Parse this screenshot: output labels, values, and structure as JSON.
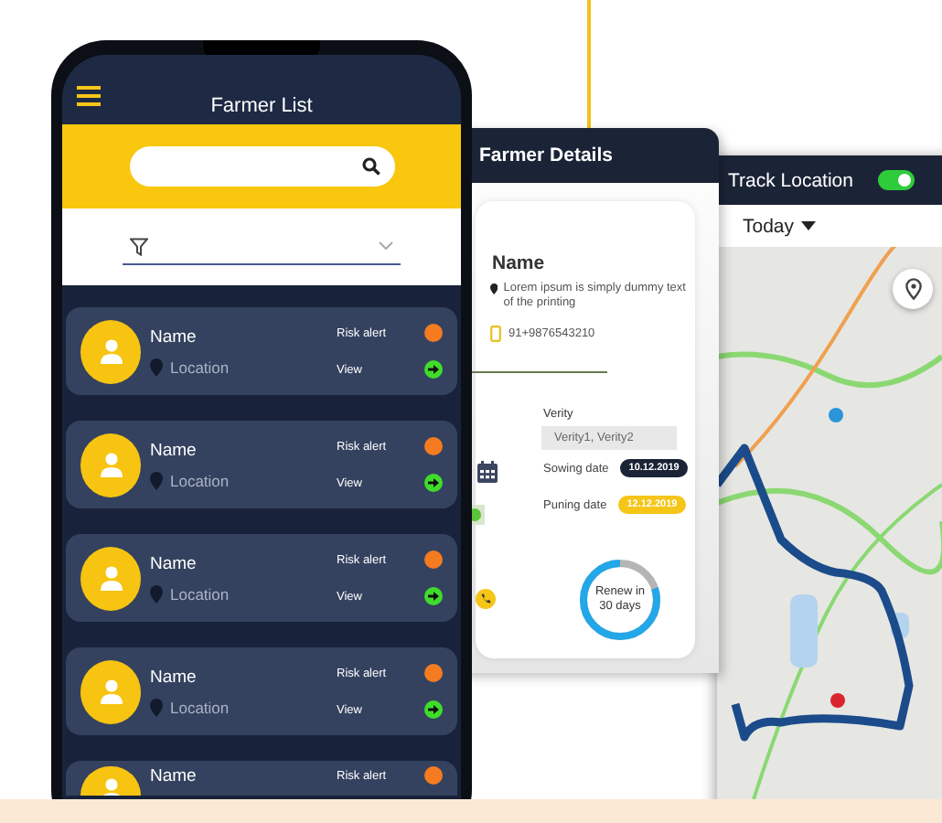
{
  "phone": {
    "title": "Farmer List",
    "farmers": [
      {
        "name": "Name",
        "location": "Location",
        "alert": "Risk alert",
        "action": "View"
      },
      {
        "name": "Name",
        "location": "Location",
        "alert": "Risk alert",
        "action": "View"
      },
      {
        "name": "Name",
        "location": "Location",
        "alert": "Risk alert",
        "action": "View"
      },
      {
        "name": "Name",
        "location": "Location",
        "alert": "Risk alert",
        "action": "View"
      },
      {
        "name": "Name",
        "alert": "Risk alert"
      }
    ]
  },
  "details": {
    "title": "Farmer Details",
    "name": "Name",
    "address": "Lorem ipsum is simply dummy text of the printing",
    "phone": "91+9876543210",
    "variety_label": "Verity",
    "variety_value": "Verity1, Verity2",
    "dates": [
      {
        "label": "Sowing date",
        "value": "10.12.2019",
        "kind": "dark"
      },
      {
        "label": "Puning date",
        "value": "12.12.2019",
        "kind": "yellow"
      }
    ],
    "renewal": {
      "text": "Renew in 30 days",
      "level": 0.8
    }
  },
  "track": {
    "title": "Track Location",
    "tracking_on": true,
    "period": "Today"
  }
}
